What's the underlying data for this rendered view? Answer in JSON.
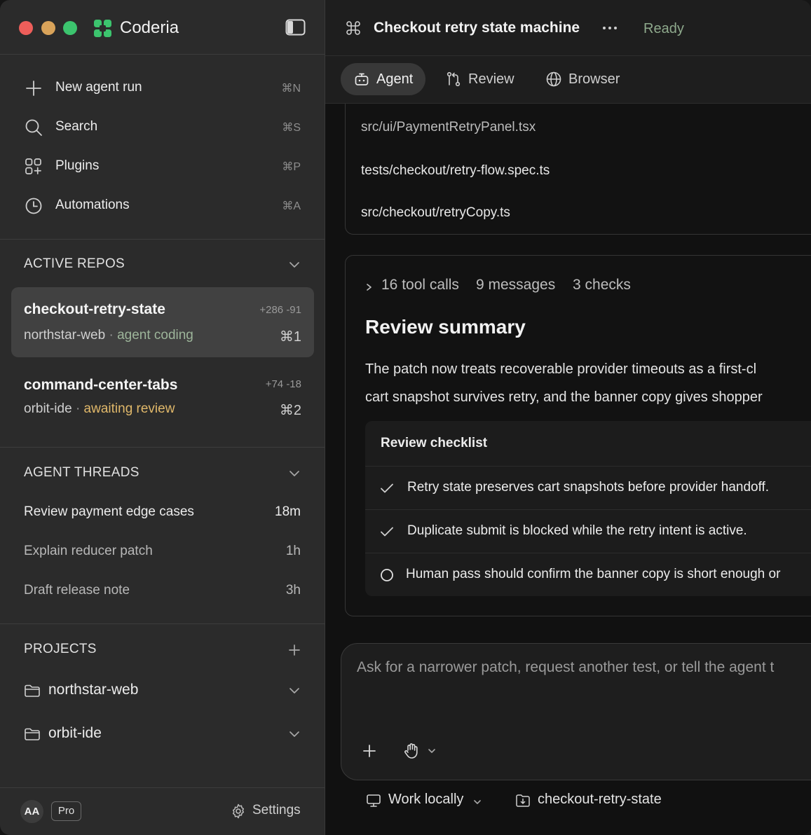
{
  "app": {
    "name": "Coderia"
  },
  "sidebar": {
    "nav": [
      {
        "icon": "plus-icon",
        "label": "New agent run",
        "shortcut": "⌘N"
      },
      {
        "icon": "search-icon",
        "label": "Search",
        "shortcut": "⌘S"
      },
      {
        "icon": "plugins-icon",
        "label": "Plugins",
        "shortcut": "⌘P"
      },
      {
        "icon": "clock-icon",
        "label": "Automations",
        "shortcut": "⌘A"
      }
    ],
    "active_repos": {
      "title": "ACTIVE REPOS",
      "items": [
        {
          "name": "checkout-retry-state",
          "diff": "+286 -91",
          "project": "northstar-web",
          "separator": "·",
          "status": "agent coding",
          "status_color": "#9db59a",
          "shortcut": "⌘1",
          "active": true
        },
        {
          "name": "command-center-tabs",
          "diff": "+74 -18",
          "project": "orbit-ide",
          "separator": "·",
          "status": "awaiting review",
          "status_color": "#e0b86a",
          "shortcut": "⌘2",
          "active": false
        }
      ]
    },
    "agent_threads": {
      "title": "AGENT THREADS",
      "items": [
        {
          "label": "Review payment edge cases",
          "time": "18m"
        },
        {
          "label": "Explain reducer patch",
          "time": "1h"
        },
        {
          "label": "Draft release note",
          "time": "3h"
        }
      ]
    },
    "projects": {
      "title": "PROJECTS",
      "items": [
        {
          "label": "northstar-web",
          "icon": "folder-icon"
        },
        {
          "label": "orbit-ide",
          "icon": "folder-icon"
        }
      ]
    },
    "footer": {
      "avatar_initials": "AA",
      "plan": "Pro",
      "settings_label": "Settings"
    }
  },
  "main": {
    "title": "Checkout retry state machine",
    "status": "Ready",
    "status_color": "#8ea98c",
    "tabs": [
      {
        "label": "Agent",
        "icon": "robot-icon",
        "active": true
      },
      {
        "label": "Review",
        "icon": "git-compare-icon",
        "active": false
      },
      {
        "label": "Browser",
        "icon": "globe-icon",
        "active": false
      }
    ],
    "files": [
      "src/ui/PaymentRetryPanel.tsx",
      "tests/checkout/retry-flow.spec.ts",
      "src/checkout/retryCopy.ts"
    ],
    "review": {
      "stats": [
        "16 tool calls",
        "9 messages",
        "3 checks"
      ],
      "heading": "Review summary",
      "body_lines": [
        "The patch now treats recoverable provider timeouts as a first-cl",
        "cart snapshot survives retry, and the banner copy gives shopper"
      ],
      "checklist_title": "Review checklist",
      "checklist": [
        {
          "text": "Retry state preserves cart snapshots before provider handoff.",
          "done": true
        },
        {
          "text": "Duplicate submit is blocked while the retry intent is active.",
          "done": true
        },
        {
          "text": "Human pass should confirm the banner copy is short enough or",
          "done": false
        }
      ]
    },
    "composer": {
      "placeholder": "Ask for a narrower patch, request another test, or tell the agent t"
    },
    "bottom_bar": {
      "environment": "Work locally",
      "branch": "checkout-retry-state"
    }
  },
  "colors": {
    "accent_green": "#3cc46e",
    "traffic_red": "#ee5e5a",
    "traffic_yellow": "#d9a35a",
    "traffic_green": "#3cc46e"
  }
}
